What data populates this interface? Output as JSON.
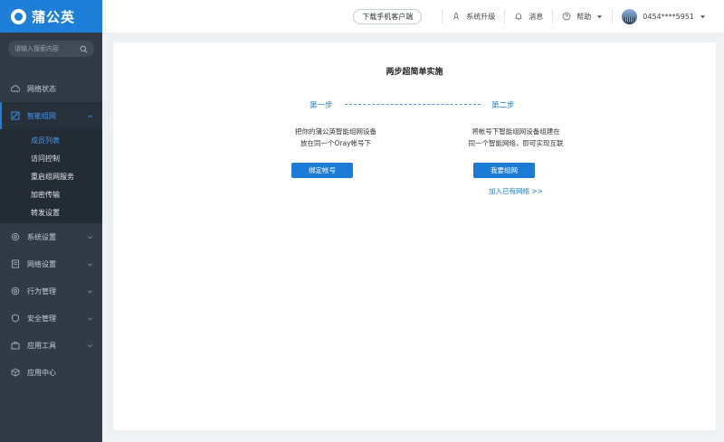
{
  "app": {
    "logo_text": "蒲公英"
  },
  "search": {
    "placeholder": "请输入搜索内容"
  },
  "sidebar": {
    "items": [
      {
        "label": "网络状态",
        "icon": "cloud-icon"
      },
      {
        "label": "智能组网",
        "icon": "network-icon",
        "active": true
      },
      {
        "label": "系统设置",
        "icon": "gear-icon"
      },
      {
        "label": "网络设置",
        "icon": "document-icon"
      },
      {
        "label": "行为管理",
        "icon": "target-icon"
      },
      {
        "label": "安全管理",
        "icon": "shield-icon"
      },
      {
        "label": "应用工具",
        "icon": "toolbox-icon"
      },
      {
        "label": "应用中心",
        "icon": "cube-icon"
      }
    ],
    "sub_items": [
      {
        "label": "成员列表",
        "active": true
      },
      {
        "label": "访问控制"
      },
      {
        "label": "重启组网服务"
      },
      {
        "label": "加密传输"
      },
      {
        "label": "转发设置"
      }
    ]
  },
  "topbar": {
    "download_label": "下载手机客户端",
    "upgrade_label": "系统升级",
    "messages_label": "消息",
    "help_label": "帮助",
    "account_label": "0454****5951"
  },
  "main": {
    "title": "两步超简单实施",
    "step1": {
      "label": "第一步",
      "desc_line1": "把你的蒲公英智能组网设备",
      "desc_line2": "放在同一个Oray帐号下",
      "button": "绑定帐号"
    },
    "step2": {
      "label": "第二步",
      "desc_line1": "将帐号下智能组网设备组建在",
      "desc_line2": "同一个智能网络，即可实现互联",
      "button": "我要组网",
      "link": "加入已有网络 >>"
    }
  },
  "colors": {
    "accent": "#1e7fd8",
    "sidebar_bg": "#313b46",
    "page_bg": "#eef0f3"
  }
}
